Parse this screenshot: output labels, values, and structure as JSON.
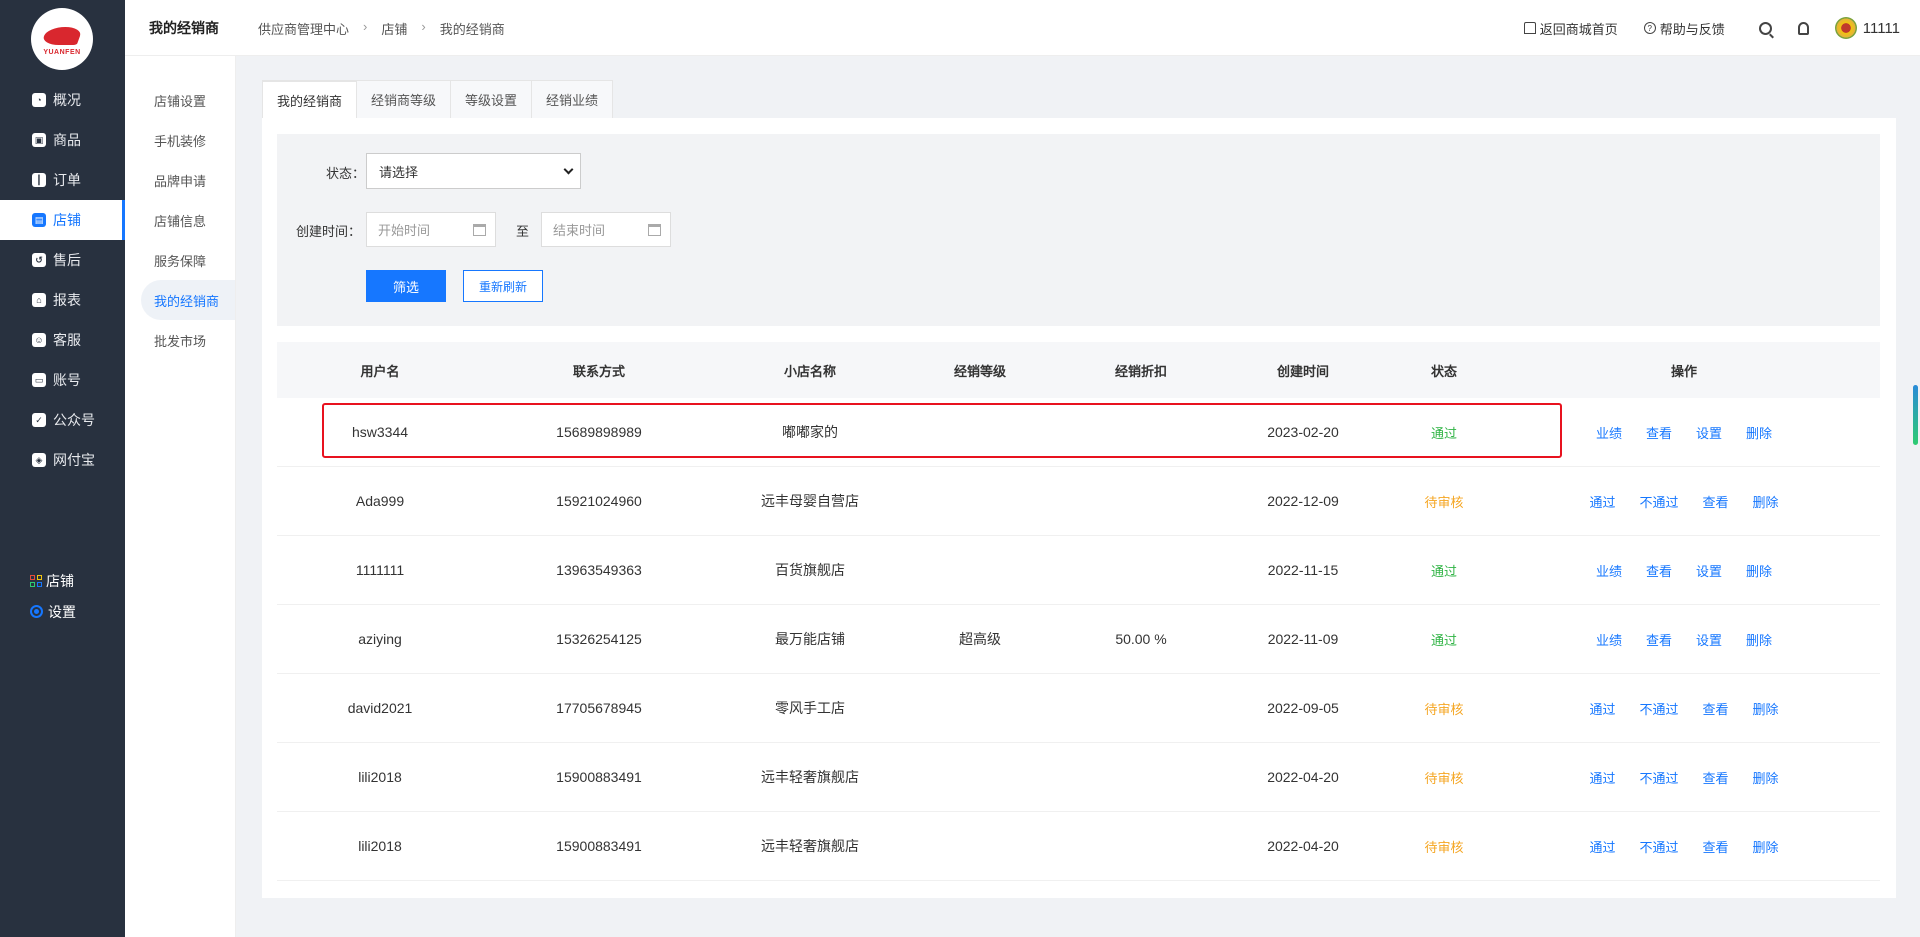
{
  "brand": {
    "logo_text": "YUANFEN"
  },
  "sidebar": {
    "items": [
      {
        "label": "概况"
      },
      {
        "label": "商品"
      },
      {
        "label": "订单"
      },
      {
        "label": "店铺"
      },
      {
        "label": "售后"
      },
      {
        "label": "报表"
      },
      {
        "label": "客服"
      },
      {
        "label": "账号"
      },
      {
        "label": "公众号"
      },
      {
        "label": "网付宝"
      }
    ],
    "extra": [
      {
        "label": "店铺"
      },
      {
        "label": "设置"
      }
    ]
  },
  "submenu": {
    "items": [
      {
        "label": "店铺设置"
      },
      {
        "label": "手机装修"
      },
      {
        "label": "品牌申请"
      },
      {
        "label": "店铺信息"
      },
      {
        "label": "服务保障"
      },
      {
        "label": "我的经销商"
      },
      {
        "label": "批发市场"
      }
    ]
  },
  "header": {
    "title": "我的经销商",
    "breadcrumb": [
      "供应商管理中心",
      "店铺",
      "我的经销商"
    ],
    "home_link": "返回商城首页",
    "help_link": "帮助与反馈",
    "username": "11111"
  },
  "tabs": [
    {
      "label": "我的经销商"
    },
    {
      "label": "经销商等级"
    },
    {
      "label": "等级设置"
    },
    {
      "label": "经销业绩"
    }
  ],
  "filter": {
    "status_label": "状态：",
    "status_value": "请选择",
    "created_label": "创建时间：",
    "start_placeholder": "开始时间",
    "to_label": "至",
    "end_placeholder": "结束时间",
    "filter_button": "筛选",
    "refresh_button": "重新刷新"
  },
  "table": {
    "headers": [
      "用户名",
      "联系方式",
      "小店名称",
      "经销等级",
      "经销折扣",
      "创建时间",
      "状态",
      "操作"
    ],
    "rows": [
      {
        "user": "hsw3344",
        "phone": "15689898989",
        "shop": "嘟嘟家的",
        "level": "",
        "discount": "",
        "date": "2023-02-20",
        "status": "通过",
        "actions": [
          "业绩",
          "查看",
          "设置",
          "删除"
        ]
      },
      {
        "user": "Ada999",
        "phone": "15921024960",
        "shop": "远丰母婴自营店",
        "level": "",
        "discount": "",
        "date": "2022-12-09",
        "status": "待审核",
        "actions": [
          "通过",
          "不通过",
          "查看",
          "删除"
        ]
      },
      {
        "user": "1111111",
        "phone": "13963549363",
        "shop": "百货旗舰店",
        "level": "",
        "discount": "",
        "date": "2022-11-15",
        "status": "通过",
        "actions": [
          "业绩",
          "查看",
          "设置",
          "删除"
        ]
      },
      {
        "user": "aziying",
        "phone": "15326254125",
        "shop": "最万能店铺",
        "level": "超高级",
        "discount": "50.00 %",
        "date": "2022-11-09",
        "status": "通过",
        "actions": [
          "业绩",
          "查看",
          "设置",
          "删除"
        ]
      },
      {
        "user": "david2021",
        "phone": "17705678945",
        "shop": "零风手工店",
        "level": "",
        "discount": "",
        "date": "2022-09-05",
        "status": "待审核",
        "actions": [
          "通过",
          "不通过",
          "查看",
          "删除"
        ]
      },
      {
        "user": "lili2018",
        "phone": "15900883491",
        "shop": "远丰轻奢旗舰店",
        "level": "",
        "discount": "",
        "date": "2022-04-20",
        "status": "待审核",
        "actions": [
          "通过",
          "不通过",
          "查看",
          "删除"
        ]
      },
      {
        "user": "lili2018",
        "phone": "15900883491",
        "shop": "远丰轻奢旗舰店",
        "level": "",
        "discount": "",
        "date": "2022-04-20",
        "status": "待审核",
        "actions": [
          "通过",
          "不通过",
          "查看",
          "删除"
        ]
      }
    ]
  },
  "colors": {
    "accent": "#1677ff",
    "sidebar": "#28313f",
    "ok": "#2fb344",
    "pending": "#f5a623",
    "highlight": "#e8121f"
  }
}
